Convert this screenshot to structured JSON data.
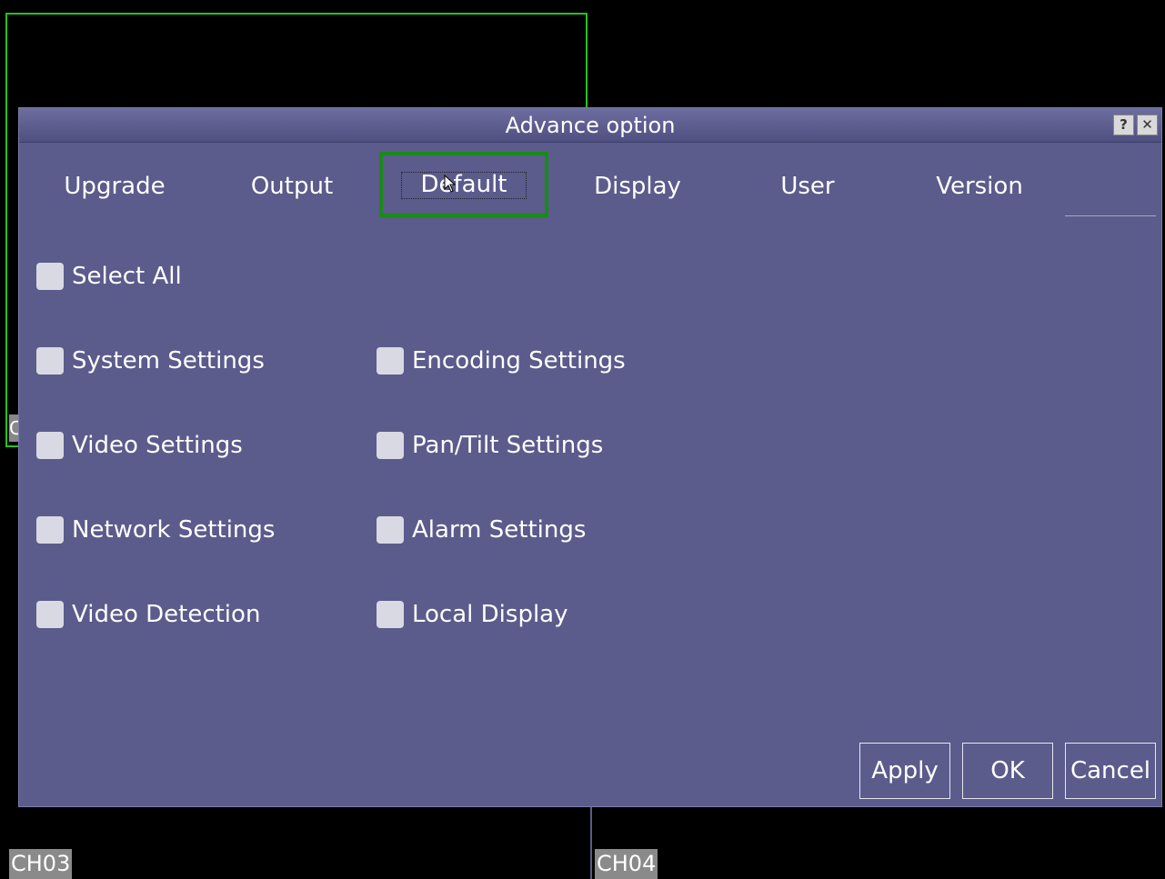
{
  "background": {
    "channels": [
      {
        "label": "CH03"
      },
      {
        "label": "CH04"
      }
    ],
    "partial_label": "C"
  },
  "dialog": {
    "title": "Advance option",
    "help_label": "?",
    "close_label": "✕",
    "tabs": [
      {
        "label": "Upgrade"
      },
      {
        "label": "Output"
      },
      {
        "label": "Default",
        "selected": true
      },
      {
        "label": "Display"
      },
      {
        "label": "User"
      },
      {
        "label": "Version"
      }
    ],
    "checkboxes": {
      "select_all": "Select All",
      "left": [
        "System Settings",
        "Video Settings",
        "Network Settings",
        "Video Detection"
      ],
      "right": [
        "Encoding Settings",
        "Pan/Tilt Settings",
        "Alarm Settings",
        "Local Display"
      ]
    },
    "buttons": {
      "apply": "Apply",
      "ok": "OK",
      "cancel": "Cancel"
    }
  },
  "colors": {
    "dialog_bg": "#5b5b8c",
    "highlight": "#1a8a1a",
    "active_channel_border": "#22c322"
  }
}
